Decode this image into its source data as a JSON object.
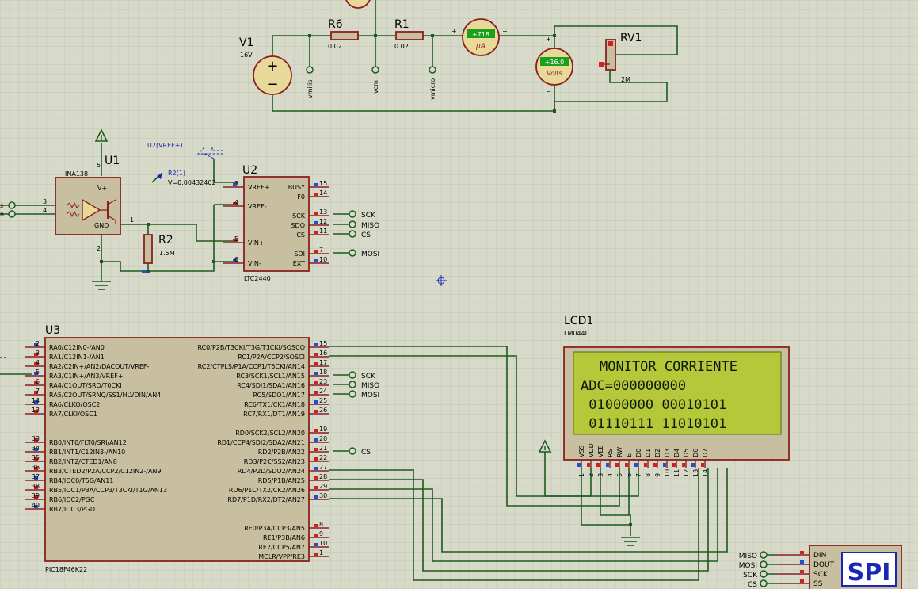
{
  "components": {
    "v1": {
      "ref": "V1",
      "value": "16V"
    },
    "r6": {
      "ref": "R6",
      "value": "0.02"
    },
    "r1": {
      "ref": "R1",
      "value": "0.02"
    },
    "ammeter": {
      "reading": "+718",
      "unit": "μA"
    },
    "voltmeter": {
      "reading": "+16.0",
      "unit": "Volts"
    },
    "rv1": {
      "ref": "RV1",
      "value": "2M"
    },
    "u1": {
      "ref": "U1",
      "part": "INA138",
      "vplus": "V+",
      "gnd": "GND"
    },
    "r2": {
      "ref": "R2",
      "value": "1.5M"
    },
    "u2": {
      "ref": "U2",
      "part": "LTC2440",
      "left_pins": [
        {
          "num": "3",
          "name": "VREF+"
        },
        {
          "num": "4",
          "name": "VREF-"
        },
        {
          "num": "5",
          "name": "VIN+"
        },
        {
          "num": "6",
          "name": "VIN-"
        }
      ],
      "right_pins": [
        {
          "num": "15",
          "name": "BUSY"
        },
        {
          "num": "14",
          "name": "F0"
        },
        {
          "num": "13",
          "name": "SCK"
        },
        {
          "num": "12",
          "name": "SDO"
        },
        {
          "num": "11",
          "name": "CS"
        },
        {
          "num": "7",
          "name": "SDI"
        },
        {
          "num": "10",
          "name": "EXT"
        }
      ]
    },
    "u3": {
      "ref": "U3",
      "part": "PIC18F46K22",
      "left_pins": [
        {
          "num": "2",
          "name": "RA0/C12IN0-/AN0"
        },
        {
          "num": "3",
          "name": "RA1/C12IN1-/AN1"
        },
        {
          "num": "4",
          "name": "RA2/C2IN+/AN2/DACOUT/VREF-"
        },
        {
          "num": "5",
          "name": "RA3/C1IN+/AN3/VREF+"
        },
        {
          "num": "6",
          "name": "RA4/C1OUT/SRQ/T0CKI"
        },
        {
          "num": "7",
          "name": "RA5/C2OUT/SRNQ/SS1/HLVDIN/AN4"
        },
        {
          "num": "14",
          "name": "RA6/CLKO/OSC2"
        },
        {
          "num": "13",
          "name": "RA7/CLKI/OSC1"
        },
        {
          "num": "33",
          "name": "RB0/INT0/FLT0/SRI/AN12"
        },
        {
          "num": "34",
          "name": "RB1/INT1/C12IN3-/AN10"
        },
        {
          "num": "35",
          "name": "RB2/INT2/CTED1/AN8"
        },
        {
          "num": "36",
          "name": "RB3/CTED2/P2A/CCP2/C12IN2-/AN9"
        },
        {
          "num": "37",
          "name": "RB4/IOC0/T5G/AN11"
        },
        {
          "num": "38",
          "name": "RB5/IOC1/P3A/CCP3/T3CKI/T1G/AN13"
        },
        {
          "num": "39",
          "name": "RB6/IOC2/PGC"
        },
        {
          "num": "40",
          "name": "RB7/IOC3/PGD"
        }
      ],
      "right_pins": [
        {
          "num": "15",
          "name": "RC0/P2B/T3CKI/T3G/T1CKI/SOSCO"
        },
        {
          "num": "16",
          "name": "RC1/P2A/CCP2/SOSCI"
        },
        {
          "num": "17",
          "name": "RC2/CTPLS/P1A/CCP1/T5CKI/AN14"
        },
        {
          "num": "18",
          "name": "RC3/SCK1/SCL1/AN15"
        },
        {
          "num": "23",
          "name": "RC4/SDI1/SDA1/AN16"
        },
        {
          "num": "24",
          "name": "RC5/SDO1/AN17"
        },
        {
          "num": "25",
          "name": "RC6/TX1/CK1/AN18"
        },
        {
          "num": "26",
          "name": "RC7/RX1/DT1/AN19"
        },
        {
          "num": "19",
          "name": "RD0/SCK2/SCL2/AN20"
        },
        {
          "num": "20",
          "name": "RD1/CCP4/SDI2/SDA2/AN21"
        },
        {
          "num": "21",
          "name": "RD2/P2B/AN22"
        },
        {
          "num": "22",
          "name": "RD3/P2C/SS2/AN23"
        },
        {
          "num": "27",
          "name": "RD4/P2D/SDO2/AN24"
        },
        {
          "num": "28",
          "name": "RD5/P1B/AN25"
        },
        {
          "num": "29",
          "name": "RD6/P1C/TX2/CK2/AN26"
        },
        {
          "num": "30",
          "name": "RD7/P1D/RX2/DT2/AN27"
        },
        {
          "num": "8",
          "name": "RE0/P3A/CCP3/AN5"
        },
        {
          "num": "9",
          "name": "RE1/P3B/AN6"
        },
        {
          "num": "10",
          "name": "RE2/CCP5/AN7"
        },
        {
          "num": "1",
          "name": "MCLR/VPP/RE3"
        }
      ]
    },
    "lcd1": {
      "ref": "LCD1",
      "part": "LM044L",
      "lines": [
        "MONITOR CORRIENTE",
        "ADC=000000000",
        " 01000000 00010101",
        " 01110111 11010101"
      ],
      "pins": [
        {
          "num": "1",
          "name": "VSS"
        },
        {
          "num": "2",
          "name": "VDD"
        },
        {
          "num": "3",
          "name": "VEE"
        },
        {
          "num": "4",
          "name": "RS"
        },
        {
          "num": "5",
          "name": "RW"
        },
        {
          "num": "6",
          "name": "E"
        },
        {
          "num": "7",
          "name": "D0"
        },
        {
          "num": "8",
          "name": "D1"
        },
        {
          "num": "9",
          "name": "D2"
        },
        {
          "num": "10",
          "name": "D3"
        },
        {
          "num": "11",
          "name": "D4"
        },
        {
          "num": "12",
          "name": "D5"
        },
        {
          "num": "13",
          "name": "D6"
        },
        {
          "num": "14",
          "name": "D7"
        }
      ]
    },
    "spi": {
      "label": "SPI",
      "pins": [
        "DIN",
        "DOUT",
        "SCK",
        "SS"
      ]
    }
  },
  "probes": {
    "vref": "U2(VREF+)",
    "r2": {
      "name": "R2(1)",
      "value": "V=0.00432402"
    }
  },
  "terminals": {
    "top": [
      "vmilis",
      "vcm",
      "vmicro"
    ],
    "u2": [
      "SCK",
      "MISO",
      "CS",
      "MOSI"
    ],
    "u3": [
      "SCK",
      "MISO",
      "MOSI",
      "CS"
    ],
    "spi_left": [
      "MISO",
      "MOSI",
      "SCK",
      "CS"
    ],
    "left_edge": [
      "s",
      "n"
    ]
  },
  "colors": {
    "background": "#d8dac9",
    "grid": "#c4c6b4",
    "wire": "#1c5a1c",
    "component_body": "#c7bfa0",
    "component_border": "#8a2020",
    "lcd_screen": "#b4c83a",
    "meter_display": "#1aa01a",
    "spi_label": "#1a27b4",
    "pin_high": "#d02020",
    "pin_low": "#2050d0"
  }
}
